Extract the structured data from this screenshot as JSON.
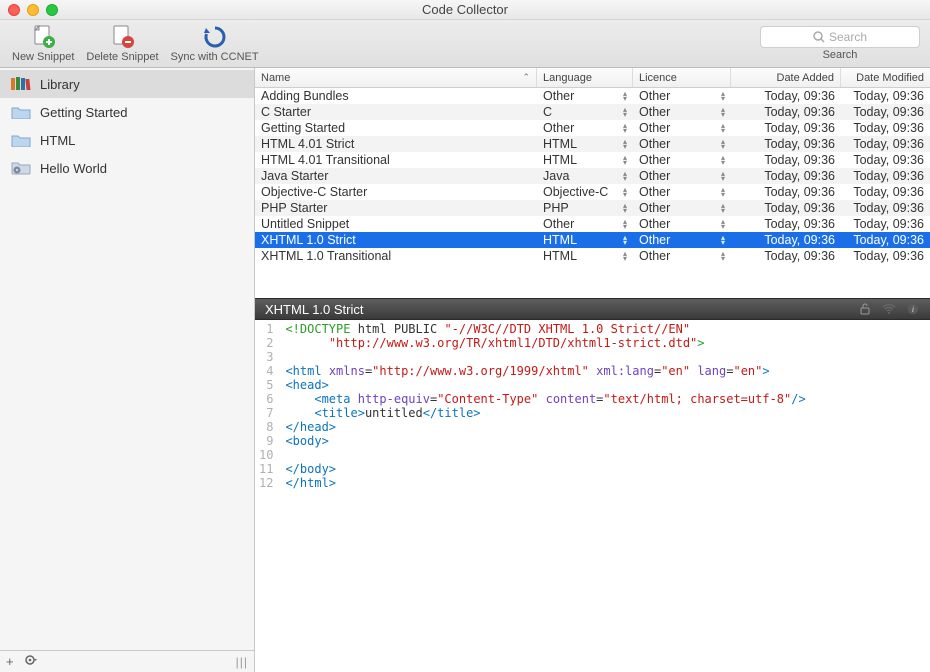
{
  "window": {
    "title": "Code Collector"
  },
  "toolbar": {
    "new_snippet": "New Snippet",
    "delete_snippet": "Delete Snippet",
    "sync": "Sync with CCNET",
    "search_placeholder": "Search",
    "search_label": "Search"
  },
  "sidebar": {
    "items": [
      {
        "label": "Library",
        "icon": "books-icon",
        "selected": true
      },
      {
        "label": "Getting Started",
        "icon": "folder-icon",
        "selected": false
      },
      {
        "label": "HTML",
        "icon": "folder-icon",
        "selected": false
      },
      {
        "label": "Hello World",
        "icon": "gear-folder-icon",
        "selected": false
      }
    ],
    "footer": {
      "add": "+",
      "gear": "⚙",
      "grip": "|||"
    }
  },
  "table": {
    "columns": {
      "name": "Name",
      "language": "Language",
      "licence": "Licence",
      "date_added": "Date Added",
      "date_modified": "Date Modified"
    },
    "rows": [
      {
        "name": "Adding Bundles",
        "language": "Other",
        "licence": "Other",
        "added": "Today, 09:36",
        "modified": "Today, 09:36"
      },
      {
        "name": "C Starter",
        "language": "C",
        "licence": "Other",
        "added": "Today, 09:36",
        "modified": "Today, 09:36"
      },
      {
        "name": "Getting Started",
        "language": "Other",
        "licence": "Other",
        "added": "Today, 09:36",
        "modified": "Today, 09:36"
      },
      {
        "name": "HTML 4.01 Strict",
        "language": "HTML",
        "licence": "Other",
        "added": "Today, 09:36",
        "modified": "Today, 09:36"
      },
      {
        "name": "HTML 4.01 Transitional",
        "language": "HTML",
        "licence": "Other",
        "added": "Today, 09:36",
        "modified": "Today, 09:36"
      },
      {
        "name": "Java Starter",
        "language": "Java",
        "licence": "Other",
        "added": "Today, 09:36",
        "modified": "Today, 09:36"
      },
      {
        "name": "Objective-C Starter",
        "language": "Objective-C",
        "licence": "Other",
        "added": "Today, 09:36",
        "modified": "Today, 09:36"
      },
      {
        "name": "PHP Starter",
        "language": "PHP",
        "licence": "Other",
        "added": "Today, 09:36",
        "modified": "Today, 09:36"
      },
      {
        "name": "Untitled Snippet",
        "language": "Other",
        "licence": "Other",
        "added": "Today, 09:36",
        "modified": "Today, 09:36"
      },
      {
        "name": "XHTML 1.0 Strict",
        "language": "HTML",
        "licence": "Other",
        "added": "Today, 09:36",
        "modified": "Today, 09:36",
        "selected": true
      },
      {
        "name": "XHTML 1.0 Transitional",
        "language": "HTML",
        "licence": "Other",
        "added": "Today, 09:36",
        "modified": "Today, 09:36"
      }
    ]
  },
  "editor": {
    "title": "XHTML 1.0 Strict",
    "lines": [
      {
        "n": 1,
        "html": "<span class='tok-green'>&lt;!</span><span class='tok-green'>DOCTYPE</span> <span class='tok-text'>html</span> <span class='tok-text'>PUBLIC</span> <span class='tok-string'>\"-//W3C//DTD XHTML 1.0 Strict//EN\"</span>"
      },
      {
        "n": 2,
        "html": "      <span class='tok-string'>\"http://www.w3.org/TR/xhtml1/DTD/xhtml1-strict.dtd\"</span><span class='tok-green'>&gt;</span>"
      },
      {
        "n": 3,
        "html": ""
      },
      {
        "n": 4,
        "html": "<span class='tok-tag'>&lt;html</span> <span class='tok-attrname'>xmlns</span>=<span class='tok-attrval'>\"http://www.w3.org/1999/xhtml\"</span> <span class='tok-attrname'>xml:lang</span>=<span class='tok-attrval'>\"en\"</span> <span class='tok-attrname'>lang</span>=<span class='tok-attrval'>\"en\"</span><span class='tok-tag'>&gt;</span>"
      },
      {
        "n": 5,
        "html": "<span class='tok-tag'>&lt;head&gt;</span>"
      },
      {
        "n": 6,
        "html": "    <span class='tok-tag'>&lt;meta</span> <span class='tok-attrname'>http-equiv</span>=<span class='tok-attrval'>\"Content-Type\"</span> <span class='tok-attrname'>content</span>=<span class='tok-attrval'>\"text/html; charset=utf-8\"</span><span class='tok-tag'>/&gt;</span>"
      },
      {
        "n": 7,
        "html": "    <span class='tok-tag'>&lt;title&gt;</span><span class='tok-text'>untitled</span><span class='tok-tag'>&lt;/title&gt;</span>"
      },
      {
        "n": 8,
        "html": "<span class='tok-tag'>&lt;/head&gt;</span>"
      },
      {
        "n": 9,
        "html": "<span class='tok-tag'>&lt;body&gt;</span>"
      },
      {
        "n": 10,
        "html": ""
      },
      {
        "n": 11,
        "html": "<span class='tok-tag'>&lt;/body&gt;</span>"
      },
      {
        "n": 12,
        "html": "<span class='tok-tag'>&lt;/html&gt;</span>"
      }
    ]
  }
}
